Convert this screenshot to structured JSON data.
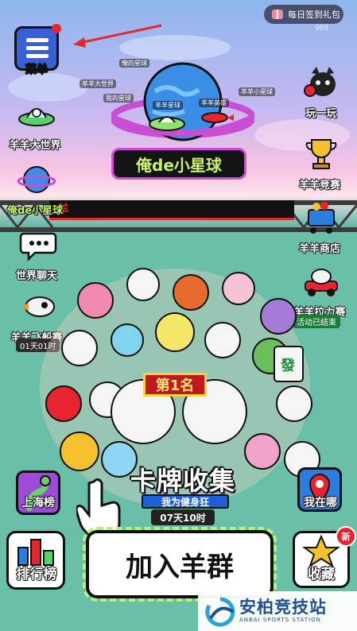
{
  "topbar": {
    "daily_signin_label": "每日签到礼包",
    "counter": "909"
  },
  "menu": {
    "label": "菜单"
  },
  "left_buttons": [
    {
      "label": "羊羊大世界",
      "icon": "ufo-icon"
    },
    {
      "label": "俺de小星球",
      "icon": "planet-icon"
    },
    {
      "label": "世界聊天",
      "icon": "chat-bubble-icon"
    },
    {
      "label": "羊羊飞船赛",
      "icon": "rocket-sheep-icon",
      "badge": "01天01时"
    }
  ],
  "right_buttons": [
    {
      "label": "玩一玩",
      "icon": "boxing-cat-icon"
    },
    {
      "label": "羊羊竞赛",
      "icon": "trophy-icon"
    },
    {
      "label": "羊羊商店",
      "icon": "shopping-cart-icon"
    },
    {
      "label": "羊羊拉力赛",
      "icon": "race-car-sheep-icon",
      "badge": "活动已结束"
    }
  ],
  "planet": {
    "title": "俺de小星球",
    "labels": [
      "羊羊大世界",
      "我的星球",
      "羊羊星球",
      "羊羊英雄",
      "羊羊小星球",
      "俺的星球"
    ]
  },
  "bridge_banner": "羊",
  "card_event": {
    "rank": "第1名",
    "title": "卡牌收集",
    "subtitle": "我为健身狂",
    "timer": "07天10时"
  },
  "bottom": {
    "shanghai": "上海榜",
    "where": "我在哪",
    "rank": "排行榜",
    "join": "加入羊群",
    "favorites": "收藏",
    "new_badge": "新"
  },
  "watermark": {
    "title": "安柏竞技站",
    "subtitle": "ANBAI SPORTS STATION"
  },
  "colors": {
    "grass": "#6abfa8",
    "accent_red": "#e8252f",
    "planet_blue": "#3a8ee6",
    "menu_blue": "#3a5fd6"
  }
}
